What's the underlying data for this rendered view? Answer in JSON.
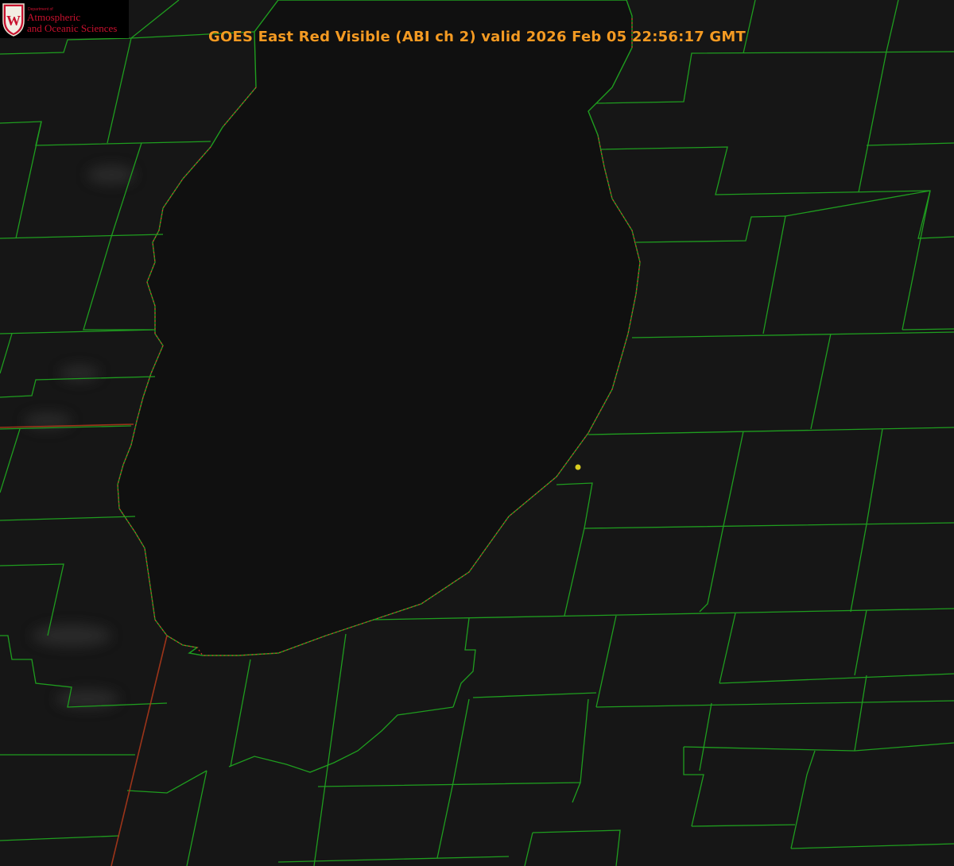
{
  "image": {
    "title": "GOES East Red Visible (ABI ch 2) valid 2026 Feb 05 22:56:17 GMT",
    "satellite_channel": "Red Visible (ABI ch 2)",
    "valid_time": "2026 Feb 05 22:56:17 GMT"
  },
  "logo": {
    "dept_text": "Department of",
    "line1": "Atmospheric",
    "line2": "and Oceanic Sciences",
    "crest_letter": "W",
    "color": "#c8102e"
  },
  "colors": {
    "background": "#141414",
    "lake": "#0f0f0f",
    "county_lines": "#1f9d1f",
    "state_line": "#d03a1a",
    "shoreline_dots": "#e03030",
    "title": "#f39a23",
    "marker": "#d8cc20"
  },
  "marker": {
    "label": "station-point"
  }
}
